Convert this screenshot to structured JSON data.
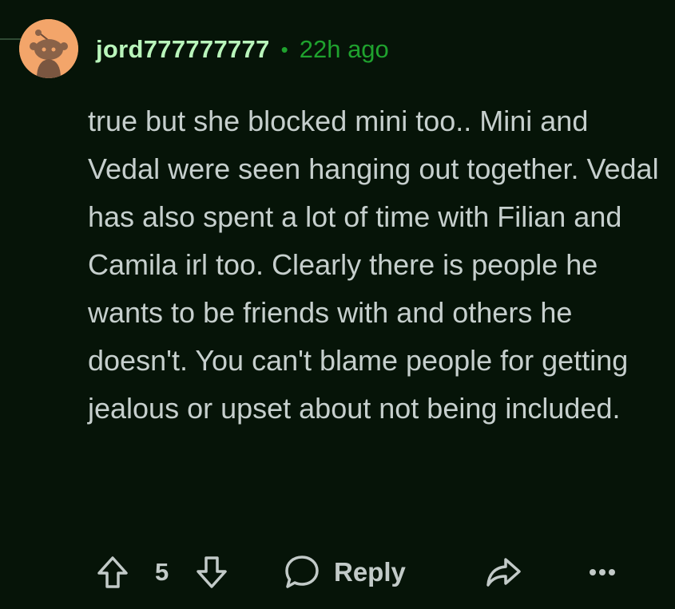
{
  "comment": {
    "username": "jord777777777",
    "separator": "•",
    "time_ago": "22h ago",
    "body": "true but she blocked mini too.. Mini and Vedal were seen hanging out together. Vedal has also spent a lot of time with Filian and Camila irl too. Clearly there is people he wants to be friends with and others he doesn't. You can't blame people for getting jealous or upset about not being included."
  },
  "actions": {
    "vote_count": "5",
    "reply_label": "Reply",
    "upvote_icon": "arrow-up-icon",
    "downvote_icon": "arrow-down-icon",
    "reply_icon": "speech-bubble-icon",
    "share_icon": "share-arrow-icon",
    "more_icon": "more-dots-icon"
  },
  "colors": {
    "background": "#061408",
    "username": "#b9f5bb",
    "timestamp": "#1fa22e",
    "text": "#c6cfcd",
    "avatar_bg": "#f3a56a"
  }
}
